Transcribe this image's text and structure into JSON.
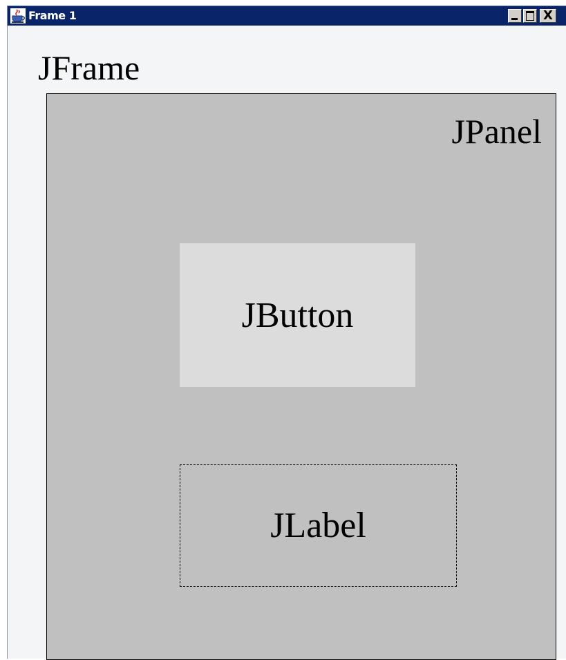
{
  "window": {
    "title": "Frame 1",
    "icon": "java-cup-icon",
    "controls": {
      "minimize": "minimize-icon",
      "maximize": "maximize-icon",
      "close_label": "X"
    }
  },
  "frame": {
    "label": "JFrame"
  },
  "panel": {
    "label": "JPanel",
    "button_label": "JButton",
    "label_text": "JLabel"
  },
  "colors": {
    "titlebar": "#0a246a",
    "frame_background": "#f3f5f6",
    "panel_background": "#c0c0c0",
    "button_background": "#dcdcdc"
  }
}
